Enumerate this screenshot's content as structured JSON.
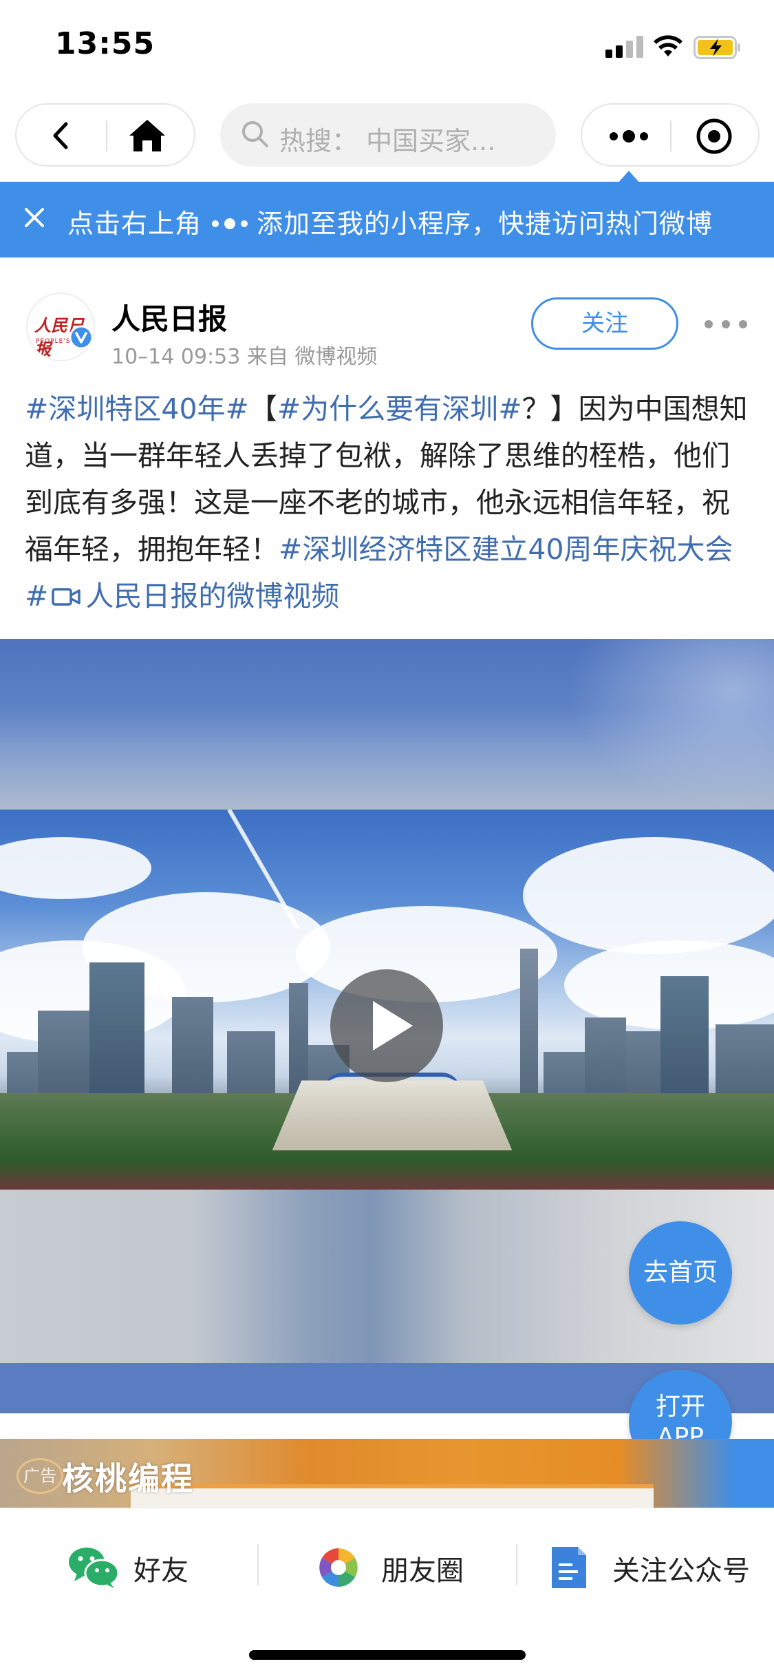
{
  "status_bar": {
    "time": "13:55"
  },
  "nav": {
    "search_placeholder": "热搜： 中国买家..."
  },
  "tip_banner": {
    "text_before": "点击右上角",
    "text_after": "添加至我的小程序，快捷访问热门微博",
    "color": "#3f8ee8"
  },
  "post": {
    "author": "人民日报",
    "avatar_logo": "人民日报",
    "avatar_sub": "PEOPLE'S D",
    "meta": "10–14 09:53 来自 微博视频",
    "follow_label": "关注",
    "body": {
      "topic1": "#深圳特区40年#",
      "bracket_open": "【",
      "topic2": "#为什么要有深圳#",
      "text1": "？】因为中国想知道，当一群年轻人丢掉了包袱，解除了思维的桎梏，他们到底有多强！这是一座不老的城市，他永远相信年轻，祝福年轻，拥抱年轻！",
      "topic3": "#深圳经济特区建立40周年庆祝大会#",
      "video_link": "人民日报的微博视频"
    },
    "link_color": "#3f6db0"
  },
  "floating": {
    "home_label": "去首页",
    "app_line1": "打开",
    "app_line2": "APP"
  },
  "ad": {
    "tag": "广告",
    "brand": "核桃编程"
  },
  "share_bar": {
    "friends": "好友",
    "moments": "朋友圈",
    "follow_account": "关注公众号"
  }
}
